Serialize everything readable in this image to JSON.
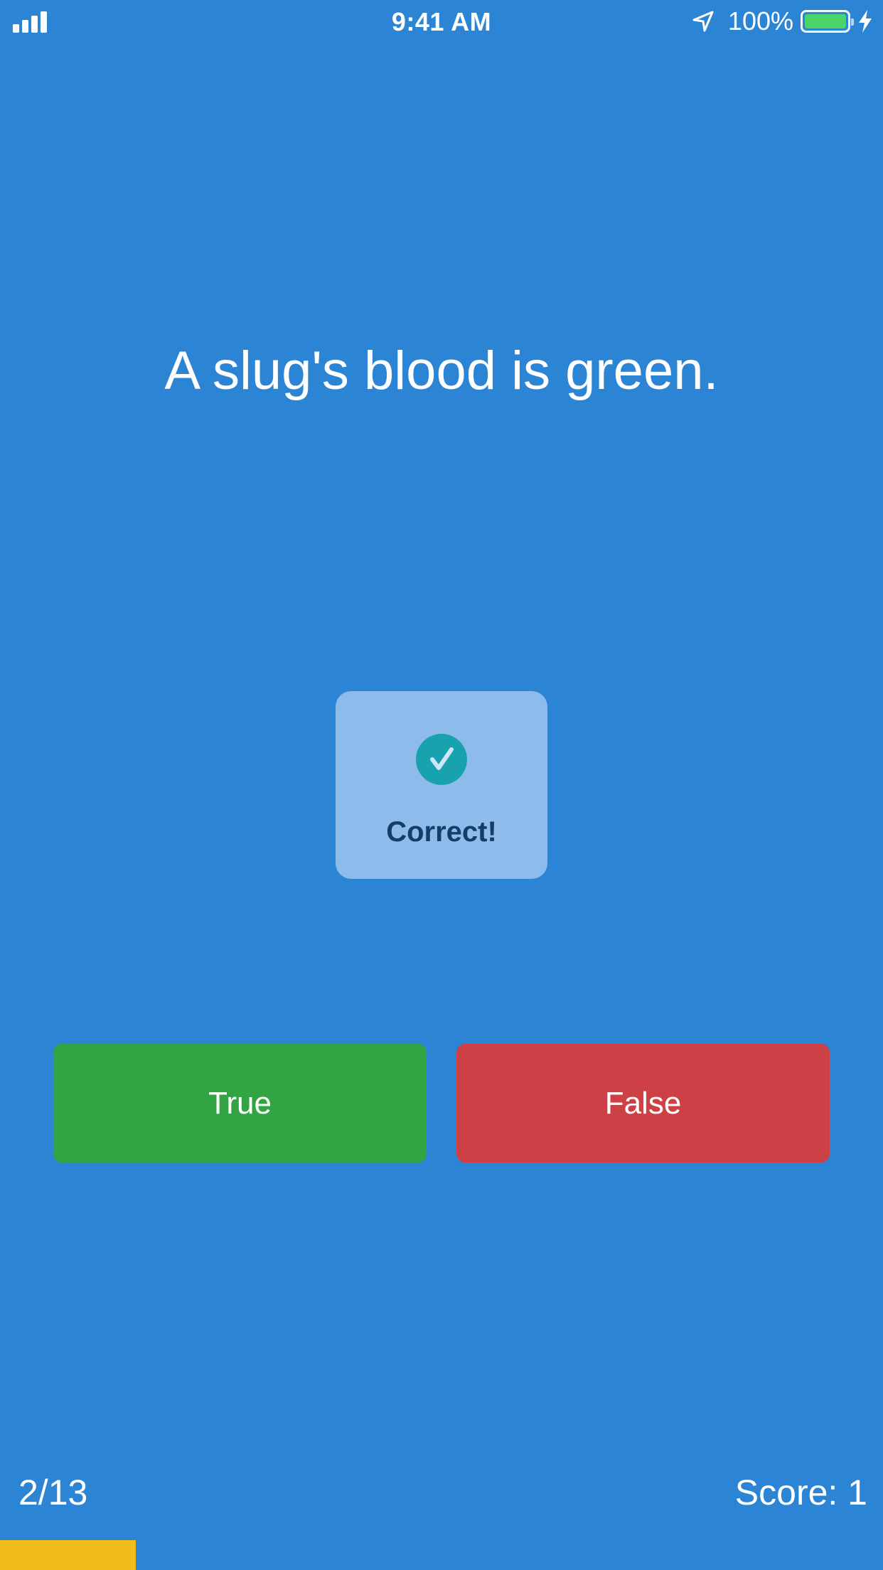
{
  "status_bar": {
    "time": "9:41 AM",
    "battery_percent": "100%",
    "battery_level": 1.0,
    "signal_bars": 4,
    "icons": [
      "cellular-signal-icon",
      "location-arrow-icon",
      "battery-icon",
      "charging-bolt-icon"
    ]
  },
  "question": {
    "text": "A slug's blood is green."
  },
  "feedback_hud": {
    "label": "Correct!",
    "icon": "checkmark-circle-icon"
  },
  "answers": {
    "true_label": "True",
    "false_label": "False"
  },
  "footer": {
    "progress_text": "2/13",
    "score_text": "Score: 1",
    "progress_fraction": 0.1538
  },
  "colors": {
    "background": "#2c84d4",
    "true_button": "#33a444",
    "false_button": "#cc4046",
    "progress_bar": "#f0bd1a",
    "hud_background": "#8dbbeb",
    "hud_check": "#17a2ad",
    "hud_text": "#143d68"
  }
}
